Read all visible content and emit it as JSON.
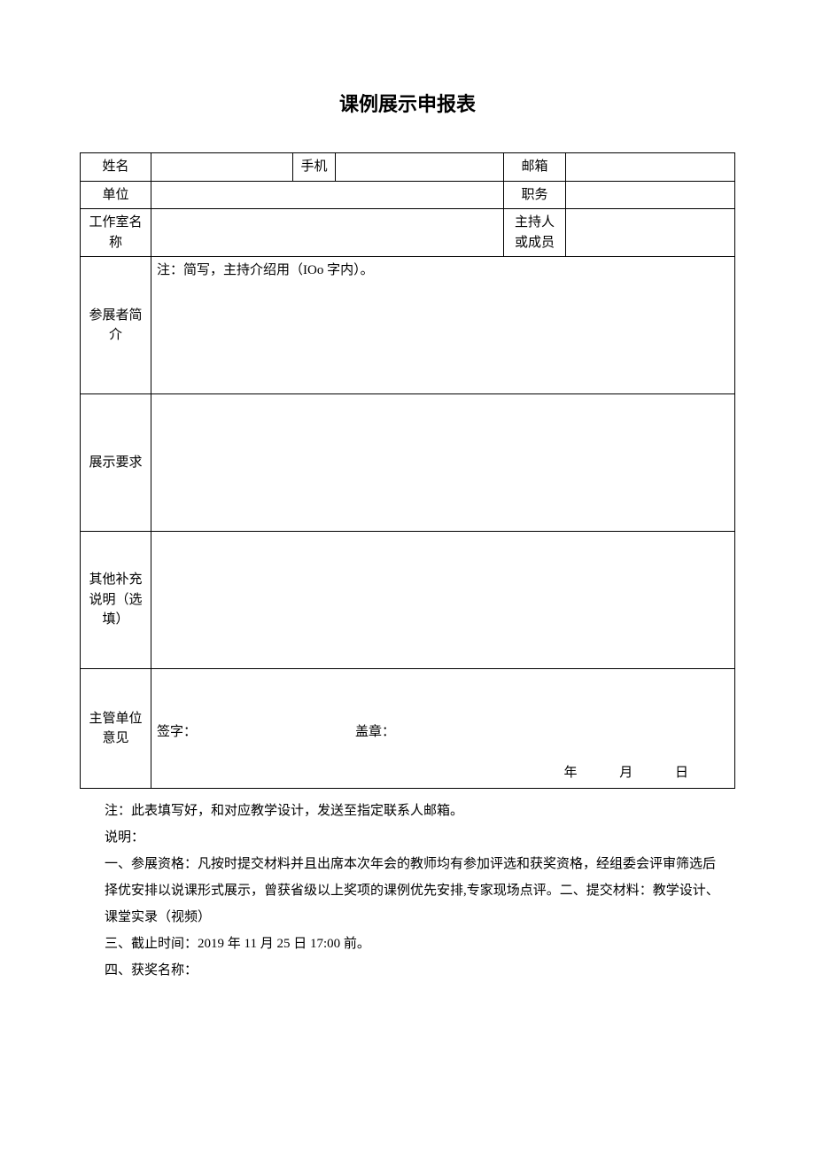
{
  "title": "课例展示申报表",
  "labels": {
    "name": "姓名",
    "phone": "手机",
    "email": "邮箱",
    "unit": "单位",
    "position": "职务",
    "studio": "工作室名称",
    "hostOrMember": "主持人或成员",
    "intro": "参展者简介",
    "introNote": "注：简写，主持介绍用（IOo 字内）。",
    "requirement": "展示要求",
    "other": "其他补充说明（选填）",
    "opinion": "主管单位意见",
    "sign": "签字：",
    "seal": "盖章：",
    "year": "年",
    "month": "月",
    "day": "日"
  },
  "values": {
    "name": "",
    "phone": "",
    "email": "",
    "unit": "",
    "position": "",
    "studio": "",
    "hostOrMember": "",
    "intro": "",
    "requirement": "",
    "other": "",
    "opinion": ""
  },
  "notes": {
    "line1": "注：此表填写好，和对应教学设计，发送至指定联系人邮箱。",
    "line2": "说明：",
    "line3": "一、参展资格：凡按时提交材料并且出席本次年会的教师均有参加评选和获奖资格，经组委会评审筛选后择优安排以说课形式展示，曾获省级以上奖项的课例优先安排,专家现场点评。二、提交材料：教学设计、课堂实录（视频）",
    "line4": "三、截止时间：2019 年 11 月 25 日 17:00 前。",
    "line5": "四、获奖名称："
  }
}
